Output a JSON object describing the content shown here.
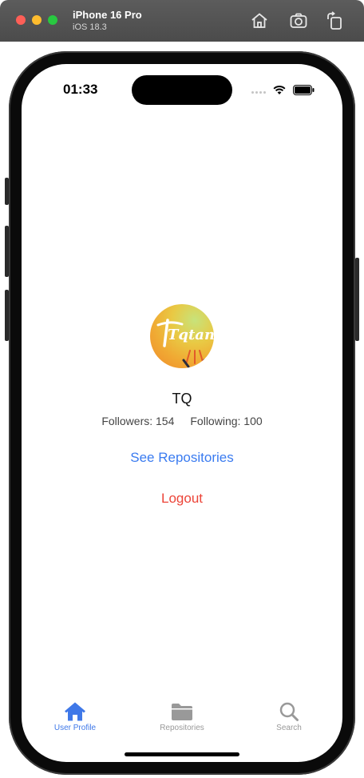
{
  "simulator": {
    "device_name": "iPhone 16 Pro",
    "os_version": "iOS 18.3",
    "toolbar_icons": [
      "home-icon",
      "screenshot-icon",
      "rotate-icon"
    ]
  },
  "status_bar": {
    "time": "01:33",
    "icons": [
      "cellular-icon",
      "wifi-icon",
      "battery-icon"
    ]
  },
  "profile": {
    "avatar_icon": "avatar-image",
    "avatar_text": "Tqtan",
    "name": "TQ",
    "followers": "Followers: 154",
    "following": "Following: 100",
    "see_repositories": "See Repositories",
    "logout": "Logout"
  },
  "colors": {
    "accent": "#3f78e8",
    "link": "#3a7bf0",
    "destructive": "#ec4438",
    "inactive": "#999999"
  },
  "tabbar": {
    "tabs": [
      {
        "label": "User Profile",
        "icon": "house-icon",
        "selected": true
      },
      {
        "label": "Repositories",
        "icon": "folder-icon",
        "selected": false
      },
      {
        "label": "Search",
        "icon": "magnifier-icon",
        "selected": false
      }
    ]
  }
}
